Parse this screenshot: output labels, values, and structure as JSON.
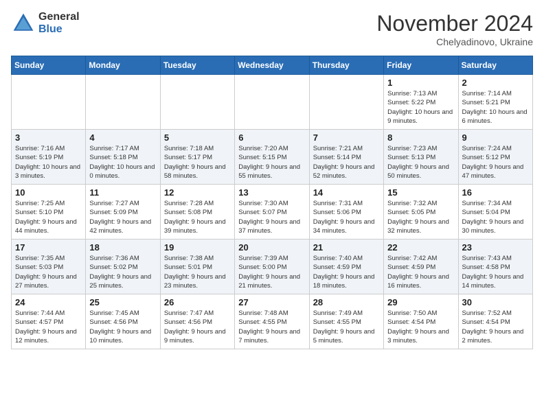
{
  "header": {
    "logo_general": "General",
    "logo_blue": "Blue",
    "month_title": "November 2024",
    "location": "Chelyadinovo, Ukraine"
  },
  "days_of_week": [
    "Sunday",
    "Monday",
    "Tuesday",
    "Wednesday",
    "Thursday",
    "Friday",
    "Saturday"
  ],
  "weeks": [
    [
      {
        "day": "",
        "info": ""
      },
      {
        "day": "",
        "info": ""
      },
      {
        "day": "",
        "info": ""
      },
      {
        "day": "",
        "info": ""
      },
      {
        "day": "",
        "info": ""
      },
      {
        "day": "1",
        "info": "Sunrise: 7:13 AM\nSunset: 5:22 PM\nDaylight: 10 hours and 9 minutes."
      },
      {
        "day": "2",
        "info": "Sunrise: 7:14 AM\nSunset: 5:21 PM\nDaylight: 10 hours and 6 minutes."
      }
    ],
    [
      {
        "day": "3",
        "info": "Sunrise: 7:16 AM\nSunset: 5:19 PM\nDaylight: 10 hours and 3 minutes."
      },
      {
        "day": "4",
        "info": "Sunrise: 7:17 AM\nSunset: 5:18 PM\nDaylight: 10 hours and 0 minutes."
      },
      {
        "day": "5",
        "info": "Sunrise: 7:18 AM\nSunset: 5:17 PM\nDaylight: 9 hours and 58 minutes."
      },
      {
        "day": "6",
        "info": "Sunrise: 7:20 AM\nSunset: 5:15 PM\nDaylight: 9 hours and 55 minutes."
      },
      {
        "day": "7",
        "info": "Sunrise: 7:21 AM\nSunset: 5:14 PM\nDaylight: 9 hours and 52 minutes."
      },
      {
        "day": "8",
        "info": "Sunrise: 7:23 AM\nSunset: 5:13 PM\nDaylight: 9 hours and 50 minutes."
      },
      {
        "day": "9",
        "info": "Sunrise: 7:24 AM\nSunset: 5:12 PM\nDaylight: 9 hours and 47 minutes."
      }
    ],
    [
      {
        "day": "10",
        "info": "Sunrise: 7:25 AM\nSunset: 5:10 PM\nDaylight: 9 hours and 44 minutes."
      },
      {
        "day": "11",
        "info": "Sunrise: 7:27 AM\nSunset: 5:09 PM\nDaylight: 9 hours and 42 minutes."
      },
      {
        "day": "12",
        "info": "Sunrise: 7:28 AM\nSunset: 5:08 PM\nDaylight: 9 hours and 39 minutes."
      },
      {
        "day": "13",
        "info": "Sunrise: 7:30 AM\nSunset: 5:07 PM\nDaylight: 9 hours and 37 minutes."
      },
      {
        "day": "14",
        "info": "Sunrise: 7:31 AM\nSunset: 5:06 PM\nDaylight: 9 hours and 34 minutes."
      },
      {
        "day": "15",
        "info": "Sunrise: 7:32 AM\nSunset: 5:05 PM\nDaylight: 9 hours and 32 minutes."
      },
      {
        "day": "16",
        "info": "Sunrise: 7:34 AM\nSunset: 5:04 PM\nDaylight: 9 hours and 30 minutes."
      }
    ],
    [
      {
        "day": "17",
        "info": "Sunrise: 7:35 AM\nSunset: 5:03 PM\nDaylight: 9 hours and 27 minutes."
      },
      {
        "day": "18",
        "info": "Sunrise: 7:36 AM\nSunset: 5:02 PM\nDaylight: 9 hours and 25 minutes."
      },
      {
        "day": "19",
        "info": "Sunrise: 7:38 AM\nSunset: 5:01 PM\nDaylight: 9 hours and 23 minutes."
      },
      {
        "day": "20",
        "info": "Sunrise: 7:39 AM\nSunset: 5:00 PM\nDaylight: 9 hours and 21 minutes."
      },
      {
        "day": "21",
        "info": "Sunrise: 7:40 AM\nSunset: 4:59 PM\nDaylight: 9 hours and 18 minutes."
      },
      {
        "day": "22",
        "info": "Sunrise: 7:42 AM\nSunset: 4:59 PM\nDaylight: 9 hours and 16 minutes."
      },
      {
        "day": "23",
        "info": "Sunrise: 7:43 AM\nSunset: 4:58 PM\nDaylight: 9 hours and 14 minutes."
      }
    ],
    [
      {
        "day": "24",
        "info": "Sunrise: 7:44 AM\nSunset: 4:57 PM\nDaylight: 9 hours and 12 minutes."
      },
      {
        "day": "25",
        "info": "Sunrise: 7:45 AM\nSunset: 4:56 PM\nDaylight: 9 hours and 10 minutes."
      },
      {
        "day": "26",
        "info": "Sunrise: 7:47 AM\nSunset: 4:56 PM\nDaylight: 9 hours and 9 minutes."
      },
      {
        "day": "27",
        "info": "Sunrise: 7:48 AM\nSunset: 4:55 PM\nDaylight: 9 hours and 7 minutes."
      },
      {
        "day": "28",
        "info": "Sunrise: 7:49 AM\nSunset: 4:55 PM\nDaylight: 9 hours and 5 minutes."
      },
      {
        "day": "29",
        "info": "Sunrise: 7:50 AM\nSunset: 4:54 PM\nDaylight: 9 hours and 3 minutes."
      },
      {
        "day": "30",
        "info": "Sunrise: 7:52 AM\nSunset: 4:54 PM\nDaylight: 9 hours and 2 minutes."
      }
    ]
  ]
}
